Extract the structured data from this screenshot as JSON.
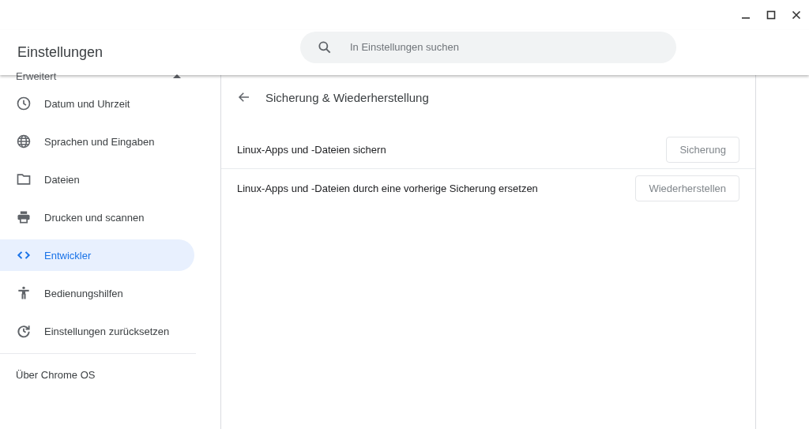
{
  "header": {
    "title": "Einstellungen",
    "search": {
      "placeholder": "In Einstellungen suchen"
    }
  },
  "sidebar": {
    "section": {
      "label": "Erweitert",
      "expanded": true
    },
    "items": [
      {
        "label": "Datum und Uhrzeit",
        "selected": false
      },
      {
        "label": "Sprachen und Eingaben",
        "selected": false
      },
      {
        "label": "Dateien",
        "selected": false
      },
      {
        "label": "Drucken und scannen",
        "selected": false
      },
      {
        "label": "Entwickler",
        "selected": true
      },
      {
        "label": "Bedienungshilfen",
        "selected": false
      },
      {
        "label": "Einstellungen zurücksetzen",
        "selected": false
      }
    ],
    "about": "Über Chrome OS"
  },
  "page": {
    "title": "Sicherung & Wiederherstellung",
    "rows": [
      {
        "label": "Linux-Apps und -Dateien sichern",
        "button": "Sicherung",
        "disabled": true
      },
      {
        "label": "Linux-Apps und -Dateien durch eine vorherige Sicherung ersetzen",
        "button": "Wiederherstellen",
        "disabled": true
      }
    ]
  }
}
